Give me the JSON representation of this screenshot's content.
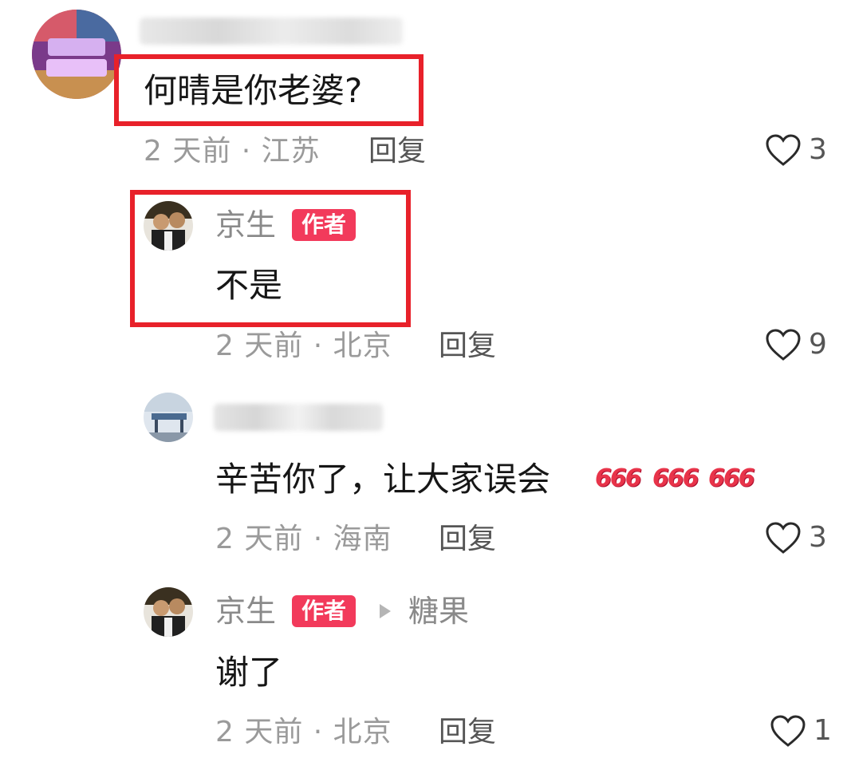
{
  "comments": [
    {
      "text": "何晴是你老婆?",
      "meta": "2 天前 · 江苏",
      "reply_label": "回复",
      "likes": "3",
      "avatar_icon": "profile-photo-icon"
    },
    {
      "username": "京生",
      "badge": "作者",
      "text": "不是",
      "meta": "2 天前 · 北京",
      "reply_label": "回复",
      "likes": "9",
      "avatar_icon": "profile-photo-icon"
    },
    {
      "text": "辛苦你了，让大家误会",
      "emojis": [
        "666",
        "666",
        "666"
      ],
      "meta": "2 天前 · 海南",
      "reply_label": "回复",
      "likes": "3",
      "avatar_icon": "profile-photo-icon"
    },
    {
      "username": "京生",
      "badge": "作者",
      "reply_to": "糖果",
      "text": "谢了",
      "meta": "2 天前 · 北京",
      "reply_label": "回复",
      "likes": "1",
      "avatar_icon": "profile-photo-icon"
    }
  ],
  "colors": {
    "highlight_box": "#e8212a",
    "author_badge": "#f23a5b",
    "meta_text": "#9a9a9a"
  },
  "icons": {
    "like": "heart-outline-icon",
    "reply_arrow": "triangle-right-icon"
  }
}
